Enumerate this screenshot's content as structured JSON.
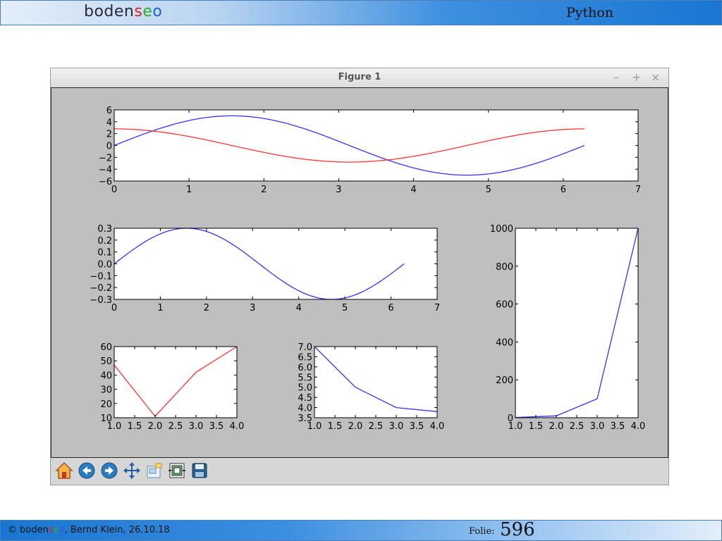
{
  "header": {
    "brand_base": "boden",
    "brand_s": "s",
    "brand_e": "e",
    "brand_o": "o",
    "title": "Python"
  },
  "window": {
    "title": "Figure 1",
    "minimize": "–",
    "maximize": "+",
    "close": "×"
  },
  "footer": {
    "copyright_prefix": "© boden",
    "copyright_s": "s",
    "copyright_e": "e",
    "copyright_o": "o",
    "copyright_rest": ", Bernd Klein, 26.10.18",
    "folie_label": "Folie:",
    "folie_number": "596"
  },
  "toolbar": {
    "icons": [
      "home-icon",
      "back-arrow-icon",
      "forward-arrow-icon",
      "pan-icon",
      "zoom-icon",
      "configure-subplots-icon",
      "save-icon"
    ]
  },
  "colors": {
    "blue": "#3333ff",
    "red": "#ff3333",
    "canvas": "#bfbfbf"
  },
  "chart_data": [
    {
      "type": "line",
      "title": "",
      "xlabel": "",
      "ylabel": "",
      "xlim": [
        0,
        7
      ],
      "ylim": [
        -6,
        6
      ],
      "xticks": [
        "0",
        "1",
        "2",
        "3",
        "4",
        "5",
        "6",
        "7"
      ],
      "yticks": [
        "−6",
        "−4",
        "−2",
        "0",
        "2",
        "4",
        "6"
      ],
      "yticks_values": [
        -6,
        -4,
        -2,
        0,
        2,
        4,
        6
      ],
      "series": [
        {
          "color": "#3333ff",
          "function": "5*sin(x)",
          "x_range": [
            0,
            6.283
          ]
        },
        {
          "color": "#ff3333",
          "function": "2.8*cos(x)",
          "x_range": [
            0,
            6.283
          ]
        }
      ]
    },
    {
      "type": "line",
      "title": "",
      "xlabel": "",
      "ylabel": "",
      "xlim": [
        0,
        7
      ],
      "ylim": [
        -0.3,
        0.3
      ],
      "xticks": [
        "0",
        "1",
        "2",
        "3",
        "4",
        "5",
        "6",
        "7"
      ],
      "yticks": [
        "−0.3",
        "−0.2",
        "−0.1",
        "0.0",
        "0.1",
        "0.2",
        "0.3"
      ],
      "yticks_values": [
        -0.3,
        -0.2,
        -0.1,
        0,
        0.1,
        0.2,
        0.3
      ],
      "series": [
        {
          "color": "#3333ff",
          "function": "0.3*sin(x)",
          "x_range": [
            0,
            6.283
          ]
        }
      ]
    },
    {
      "type": "line",
      "title": "",
      "xlabel": "",
      "ylabel": "",
      "xlim": [
        1,
        4
      ],
      "ylim": [
        10,
        60
      ],
      "xticks": [
        "1.0",
        "1.5",
        "2.0",
        "2.5",
        "3.0",
        "3.5",
        "4.0"
      ],
      "yticks": [
        "10",
        "20",
        "30",
        "40",
        "50",
        "60"
      ],
      "yticks_values": [
        10,
        20,
        30,
        40,
        50,
        60
      ],
      "series": [
        {
          "color": "#ff3333",
          "x": [
            1,
            2,
            3,
            4
          ],
          "values": [
            47,
            11,
            42,
            60
          ]
        }
      ]
    },
    {
      "type": "line",
      "title": "",
      "xlabel": "",
      "ylabel": "",
      "xlim": [
        1,
        4
      ],
      "ylim": [
        3.5,
        7.0
      ],
      "xticks": [
        "1.0",
        "1.5",
        "2.0",
        "2.5",
        "3.0",
        "3.5",
        "4.0"
      ],
      "yticks": [
        "3.5",
        "4.0",
        "4.5",
        "5.0",
        "5.5",
        "6.0",
        "6.5",
        "7.0"
      ],
      "yticks_values": [
        3.5,
        4,
        4.5,
        5,
        5.5,
        6,
        6.5,
        7
      ],
      "series": [
        {
          "color": "#3333ff",
          "x": [
            1,
            2,
            3,
            4
          ],
          "values": [
            7.0,
            5.0,
            4.0,
            3.8
          ]
        }
      ]
    },
    {
      "type": "line",
      "title": "",
      "xlabel": "",
      "ylabel": "",
      "xlim": [
        1,
        4
      ],
      "ylim": [
        0,
        1000
      ],
      "xticks": [
        "1.0",
        "1.5",
        "2.0",
        "2.5",
        "3.0",
        "3.5",
        "4.0"
      ],
      "yticks": [
        "0",
        "200",
        "400",
        "600",
        "800",
        "1000"
      ],
      "yticks_values": [
        0,
        200,
        400,
        600,
        800,
        1000
      ],
      "series": [
        {
          "color": "#3333ff",
          "x": [
            1,
            2,
            3,
            4
          ],
          "values": [
            1,
            10,
            100,
            1000
          ]
        }
      ]
    }
  ]
}
